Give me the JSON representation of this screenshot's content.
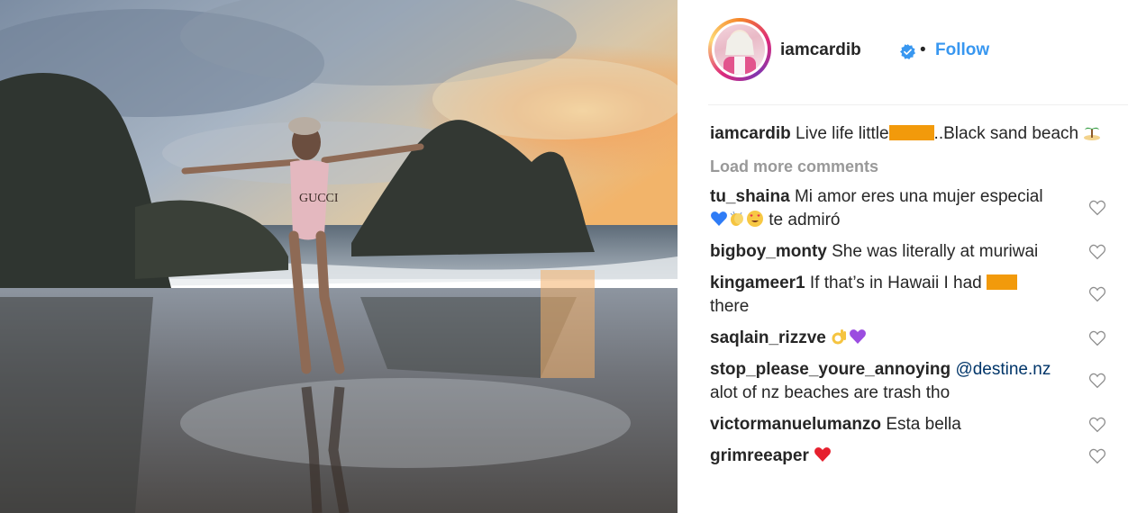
{
  "post": {
    "username": "iamcardib",
    "follow_label": "Follow",
    "separator": "•",
    "caption": {
      "user": "iamcardib",
      "text_before": "Live life little",
      "text_after": "..Black sand beach"
    }
  },
  "load_more_label": "Load more comments",
  "comments": [
    {
      "user": "tu_shaina",
      "text_a": "Mi amor eres una mujer especial",
      "text_b": "te admiró"
    },
    {
      "user": "bigboy_monty",
      "text": "She was literally at muriwai"
    },
    {
      "user": "kingameer1",
      "text_before": "If that’s in Hawaii I had",
      "text_after": "there"
    },
    {
      "user": "saqlain_rizzve"
    },
    {
      "user": "stop_please_youre_annoying",
      "mention": "@destine.nz",
      "text": "alot of nz beaches are trash tho"
    },
    {
      "user": "victormanuelumanzo",
      "text": "Esta bella"
    },
    {
      "user": "grimreeaper"
    }
  ],
  "colors": {
    "follow": "#3897f0",
    "redaction": "#f29a0b",
    "verified": "#3897f0",
    "load_more": "#999999"
  },
  "icons": [
    "verified-badge-icon",
    "heart-icon",
    "island-emoji",
    "blue-heart-emoji",
    "clap-emoji",
    "heart-eyes-emoji",
    "ok-hand-emoji",
    "purple-heart-emoji",
    "red-heart-emoji"
  ]
}
